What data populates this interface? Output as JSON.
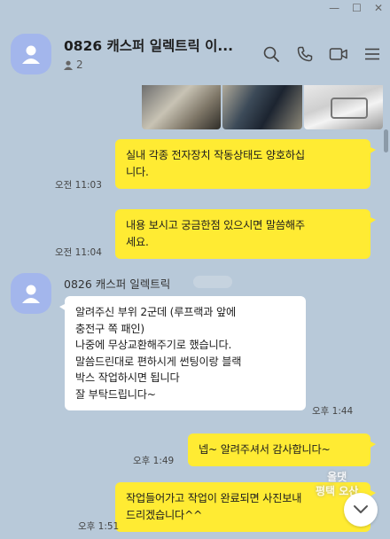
{
  "window": {
    "minimize_glyph": "—",
    "maximize_glyph": "☐",
    "close_glyph": "✕"
  },
  "header": {
    "title": "0826 캐스퍼 일렉트릭 이...",
    "member_count": "2",
    "icons": [
      "search-icon",
      "phone-icon",
      "video-icon",
      "menu-icon"
    ]
  },
  "messages": [
    {
      "sender": "me",
      "lines": [
        "실내 각종 전자장치 작동상태도 양호하십",
        "니다."
      ],
      "time": "오전 11:03"
    },
    {
      "sender": "me",
      "lines": [
        "내용 보시고 궁금한점 있으시면 말씀해주",
        "세요."
      ],
      "time": "오전 11:04"
    },
    {
      "sender": "other",
      "name": "0826 캐스퍼 일렉트릭",
      "lines": [
        "알려주신 부위 2군데 (루프랙과 앞에",
        "충전구 쪽 패인)",
        "나중에 무상교환해주기로 했습니다.",
        "말씀드린대로 편하시게 썬팅이랑 블랙",
        "박스 작업하시면 됩니다",
        "잘 부탁드립니다~"
      ],
      "time": "오후 1:44"
    },
    {
      "sender": "me",
      "lines": [
        "넵~ 알려주셔서 감사합니다~"
      ],
      "time": "오후 1:49"
    },
    {
      "sender": "me",
      "lines": [
        "작업들어가고 작업이 완료되면 사진보내",
        "드리겠습니다^^"
      ],
      "time": "오후 1:51"
    }
  ],
  "watermark": {
    "line1": "올댓",
    "line2": "평택 오산"
  },
  "colors": {
    "background": "#b8c9d9",
    "my_bubble": "#ffeb33",
    "their_bubble": "#ffffff",
    "avatar": "#a3b6ec"
  }
}
